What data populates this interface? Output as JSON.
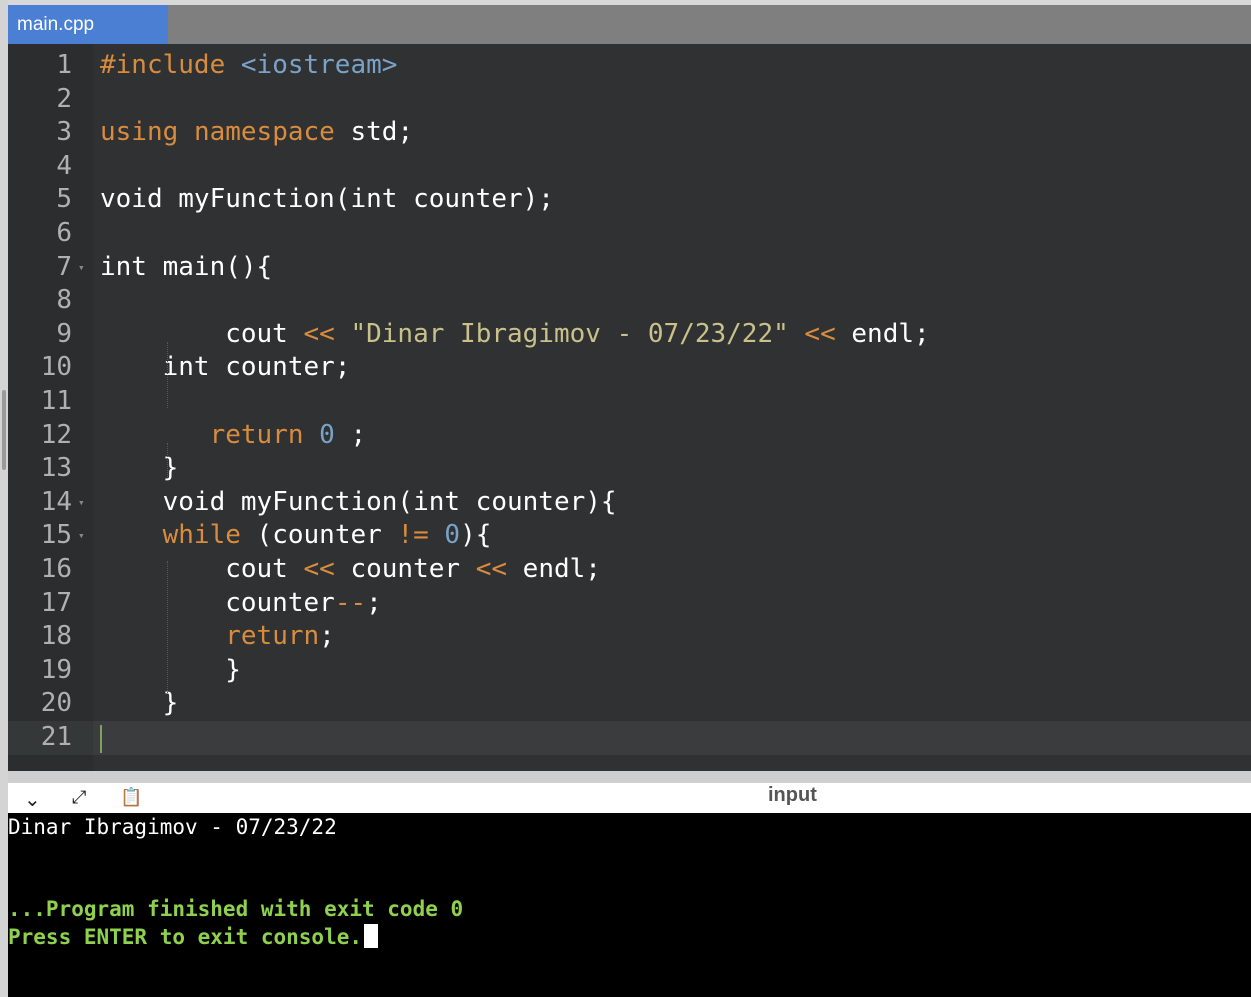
{
  "tab": {
    "title": "main.cpp"
  },
  "editor": {
    "lines": [
      {
        "n": "1",
        "tokens": [
          [
            "inc",
            "#include "
          ],
          [
            "incfile",
            "<iostream>"
          ]
        ]
      },
      {
        "n": "2",
        "tokens": []
      },
      {
        "n": "3",
        "tokens": [
          [
            "kw",
            "using"
          ],
          [
            "",
            " "
          ],
          [
            "kw",
            "namespace"
          ],
          [
            "",
            " std;"
          ]
        ]
      },
      {
        "n": "4",
        "tokens": []
      },
      {
        "n": "5",
        "tokens": [
          [
            "",
            "void myFunction(int counter);"
          ]
        ]
      },
      {
        "n": "6",
        "tokens": []
      },
      {
        "n": "7",
        "tokens": [
          [
            "",
            "int main(){"
          ]
        ],
        "fold": true
      },
      {
        "n": "8",
        "tokens": []
      },
      {
        "n": "9",
        "tokens": [
          [
            "",
            "        cout "
          ],
          [
            "op",
            "<<"
          ],
          [
            "",
            " "
          ],
          [
            "str",
            "\"Dinar Ibragimov - 07/23/22\""
          ],
          [
            "",
            " "
          ],
          [
            "op",
            "<<"
          ],
          [
            "",
            " endl;"
          ]
        ]
      },
      {
        "n": "10",
        "tokens": [
          [
            "",
            "    int counter;"
          ]
        ]
      },
      {
        "n": "11",
        "tokens": []
      },
      {
        "n": "12",
        "tokens": [
          [
            "",
            "       "
          ],
          [
            "kw",
            "return"
          ],
          [
            "",
            " "
          ],
          [
            "num-lit",
            "0"
          ],
          [
            "",
            " ;"
          ]
        ]
      },
      {
        "n": "13",
        "tokens": [
          [
            "",
            "    }"
          ]
        ]
      },
      {
        "n": "14",
        "tokens": [
          [
            "",
            "    void myFunction(int counter){"
          ]
        ],
        "fold": true
      },
      {
        "n": "15",
        "tokens": [
          [
            "",
            "    "
          ],
          [
            "kw",
            "while"
          ],
          [
            "",
            " (counter "
          ],
          [
            "op",
            "!="
          ],
          [
            "",
            " "
          ],
          [
            "num-lit",
            "0"
          ],
          [
            "",
            "){"
          ]
        ],
        "fold": true
      },
      {
        "n": "16",
        "tokens": [
          [
            "",
            "        cout "
          ],
          [
            "op",
            "<<"
          ],
          [
            "",
            " counter "
          ],
          [
            "op",
            "<<"
          ],
          [
            "",
            " endl;"
          ]
        ]
      },
      {
        "n": "17",
        "tokens": [
          [
            "",
            "        counter"
          ],
          [
            "op",
            "--"
          ],
          [
            "",
            ";"
          ]
        ]
      },
      {
        "n": "18",
        "tokens": [
          [
            "",
            "        "
          ],
          [
            "kw",
            "return"
          ],
          [
            "",
            ";"
          ]
        ]
      },
      {
        "n": "19",
        "tokens": [
          [
            "",
            "        }"
          ]
        ]
      },
      {
        "n": "20",
        "tokens": [
          [
            "",
            "    }"
          ]
        ]
      },
      {
        "n": "21",
        "tokens": []
      }
    ]
  },
  "console": {
    "title": "input",
    "icons": {
      "collapse": "chevron-down-icon",
      "expand": "expand-arrows-icon",
      "copy": "clipboard-icon"
    },
    "output_line": "Dinar Ibragimov - 07/23/22",
    "finished_line": "...Program finished with exit code 0",
    "exit_line": "Press ENTER to exit console."
  },
  "colors": {
    "keyword": "#d98c3e",
    "string": "#c9c08a",
    "number": "#7aa2c8",
    "console_green": "#8fd14f",
    "tab_blue": "#4a7fd4"
  }
}
